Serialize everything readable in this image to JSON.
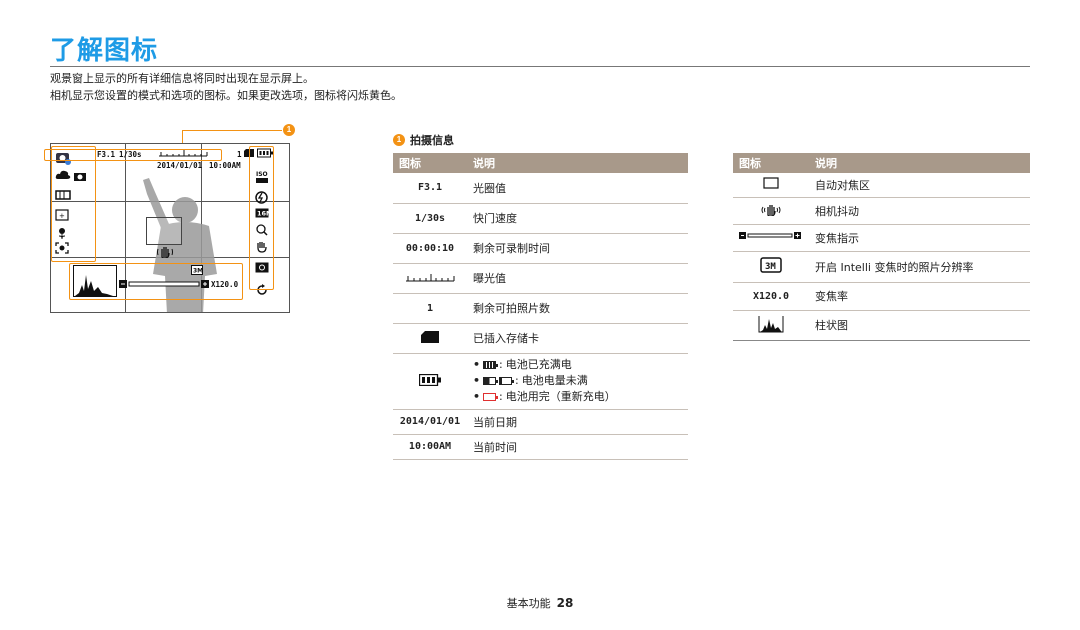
{
  "page": {
    "title": "了解图标",
    "intro_line1": "观景窗上显示的所有详细信息将同时出现在显示屏上。",
    "intro_line2": "相机显示您设置的模式和选项的图标。如果更改选项，图标将闪烁黄色。",
    "callout_number": "1",
    "footer_label": "基本功能",
    "footer_page": "28"
  },
  "screen": {
    "aperture": "F3.1",
    "shutter": "1/30s",
    "date": "2014/01/01",
    "time": "10:00AM",
    "shots": "1",
    "zoom": "X120.0"
  },
  "section": {
    "number": "1",
    "heading": "拍摄信息"
  },
  "table1": {
    "col_icon": "图标",
    "col_desc": "说明",
    "rows": [
      {
        "icon": "F3.1",
        "desc": "光圈值"
      },
      {
        "icon": "1/30s",
        "desc": "快门速度"
      },
      {
        "icon": "00:00:10",
        "desc": "剩余可录制时间"
      },
      {
        "icon": "exposure-scale-icon",
        "desc": "曝光值"
      },
      {
        "icon": "1",
        "desc": "剩余可拍照片数"
      },
      {
        "icon": "memory-card-icon",
        "desc": "已插入存储卡"
      },
      {
        "icon": "battery-icon",
        "desc_full": "电池已充满电",
        "desc_partial": "电池电量未满",
        "desc_empty": "电池用完（重新充电）",
        "sep": ":"
      },
      {
        "icon": "2014/01/01",
        "desc": "当前日期"
      },
      {
        "icon": "10:00AM",
        "desc": "当前时间"
      }
    ]
  },
  "table2": {
    "col_icon": "图标",
    "col_desc": "说明",
    "rows": [
      {
        "icon": "af-frame-icon",
        "desc": "自动对焦区"
      },
      {
        "icon": "camera-shake-icon",
        "desc": "相机抖动"
      },
      {
        "icon": "zoom-bar-icon",
        "desc": "变焦指示"
      },
      {
        "icon": "intelli-zoom-icon",
        "desc": "开启 Intelli 变焦时的照片分辨率"
      },
      {
        "icon": "X120.0",
        "desc": "变焦率"
      },
      {
        "icon": "histogram-icon",
        "desc": "柱状图"
      }
    ]
  },
  "colors": {
    "title_blue": "#1e9be6",
    "highlight_orange": "#f39214",
    "table_header": "#a8998a",
    "battery_empty_red": "#e03030"
  }
}
